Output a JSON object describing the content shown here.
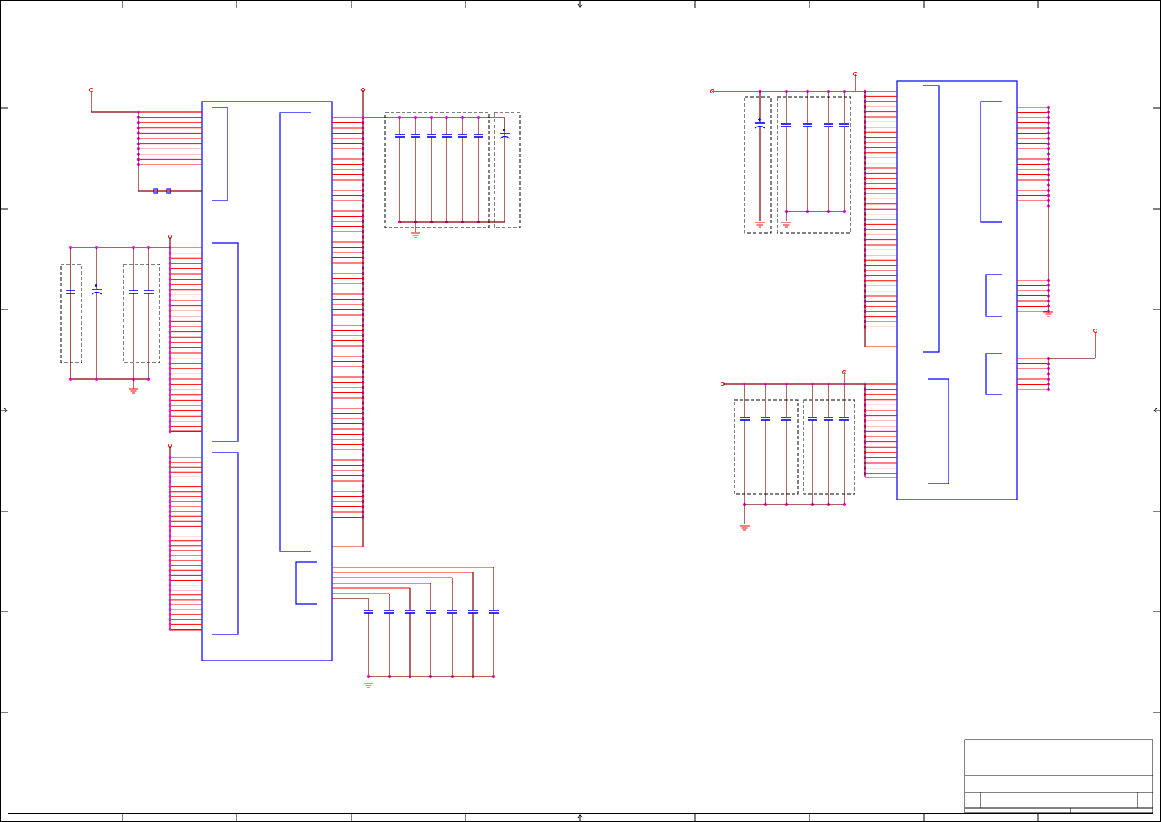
{
  "sheet": {
    "frame_color": "#000000",
    "component_color": "#0000ff",
    "wire_color": "#800000",
    "pin_color": "#ff0000",
    "junction_color": "#ff00ff"
  },
  "icons": {
    "power_port": "power-port-icon",
    "ground": "ground-icon",
    "capacitor": "capacitor-icon",
    "polarized_capacitor": "polarized-capacitor-icon",
    "zone_arrow": "arrow-icon"
  }
}
